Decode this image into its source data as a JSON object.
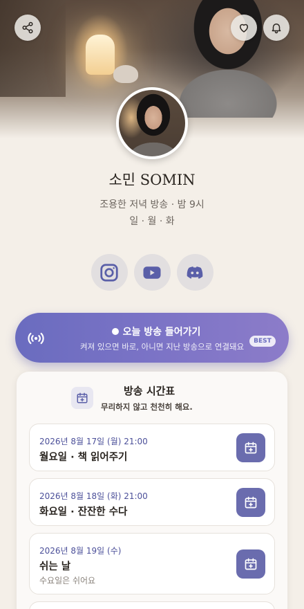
{
  "profile": {
    "name": "소민 SOMIN",
    "tagline": "조용한 저녁 방송 · 밤 9시",
    "days": "일 · 월 · 화"
  },
  "header": {
    "icons": [
      "share-icon",
      "heart-icon",
      "bell-icon"
    ]
  },
  "social": {
    "icons": [
      "instagram-icon",
      "youtube-icon",
      "discord-icon"
    ]
  },
  "live": {
    "title": "오늘 방송 들어가기",
    "description": "켜져 있으면 바로, 아니면 지난 방송으로 연결돼요",
    "badge": "BEST"
  },
  "schedule": {
    "title": "방송 시간표",
    "subtitle": "무리하지 않고 천천히 해요.",
    "entries": [
      {
        "date": "2026년 8월 17일 (월) 21:00",
        "title": "월요일 · 책 읽어주기",
        "note": ""
      },
      {
        "date": "2026년 8월 18일 (화) 21:00",
        "title": "화요일 · 잔잔한 수다",
        "note": ""
      },
      {
        "date": "2026년 8월 19일 (수)",
        "title": "쉬는 날",
        "note": "수요일은 쉬어요"
      }
    ]
  },
  "colors": {
    "accent": "#6a6cbf",
    "background": "#f4efe8",
    "date_text": "#4b4f99"
  }
}
